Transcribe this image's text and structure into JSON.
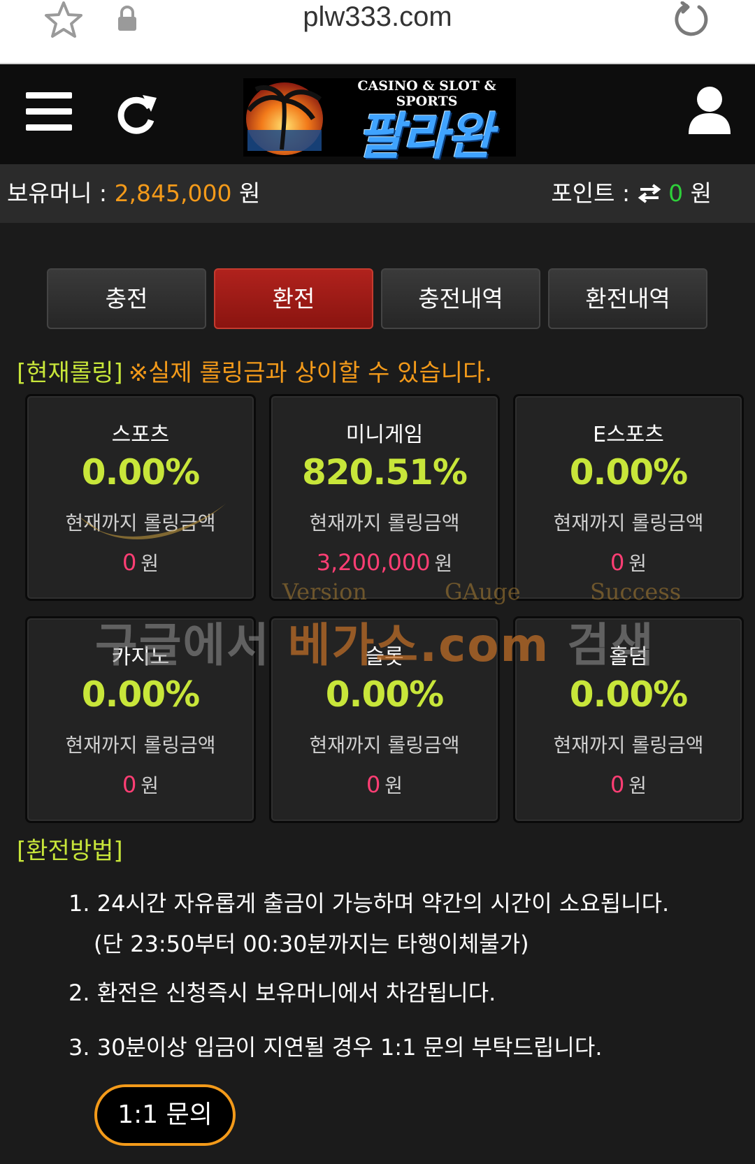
{
  "browser": {
    "url": "plw333.com",
    "icons": [
      "star-icon",
      "lock-icon",
      "reload-icon"
    ]
  },
  "header": {
    "logo_tagline": "CASINO & SLOT & SPORTS",
    "logo_brand": "팔라완",
    "icons": [
      "menu-icon",
      "refresh-icon",
      "user-icon"
    ]
  },
  "balance": {
    "label": "보유머니 :",
    "amount": "2,845,000",
    "unit": "원",
    "point_label": "포인트 :",
    "point_amount": "0",
    "point_unit": "원"
  },
  "tabs": [
    {
      "label": "충전",
      "active": false
    },
    {
      "label": "환전",
      "active": true
    },
    {
      "label": "충전내역",
      "active": false
    },
    {
      "label": "환전내역",
      "active": false
    }
  ],
  "rolling": {
    "title": "[현재롤링]",
    "note": "※실제 롤링금과 상이할 수 있습니다.",
    "cards": [
      {
        "name": "스포츠",
        "pct": "0.00%",
        "sub": "현재까지 롤링금액",
        "amount": "0",
        "unit": "원"
      },
      {
        "name": "미니게임",
        "pct": "820.51%",
        "sub": "현재까지 롤링금액",
        "amount": "3,200,000",
        "unit": "원"
      },
      {
        "name": "E스포츠",
        "pct": "0.00%",
        "sub": "현재까지 롤링금액",
        "amount": "0",
        "unit": "원"
      },
      {
        "name": "카지노",
        "pct": "0.00%",
        "sub": "현재까지 롤링금액",
        "amount": "0",
        "unit": "원"
      },
      {
        "name": "슬롯",
        "pct": "0.00%",
        "sub": "현재까지 롤링금액",
        "amount": "0",
        "unit": "원"
      },
      {
        "name": "홀덤",
        "pct": "0.00%",
        "sub": "현재까지 롤링금액",
        "amount": "0",
        "unit": "원"
      }
    ]
  },
  "watermark": {
    "main_prefix": "구글에서 ",
    "main_brand": "베가스.com",
    "main_suffix": " 검색",
    "words": [
      "Version",
      "GAuge",
      "Success"
    ]
  },
  "method": {
    "title": "[환전방법]",
    "items": [
      {
        "line1": "1. 24시간 자유롭게 출금이 가능하며 약간의 시간이 소요됩니다.",
        "line2": "(단 23:50부터 00:30분까지는 타행이체불가)"
      },
      {
        "line1": "2. 환전은 신청즉시 보유머니에서 차감됩니다.",
        "line2": ""
      },
      {
        "line1": "3. 30분이상 입금이 지연될 경우 1:1 문의 부탁드립니다.",
        "line2": ""
      }
    ]
  },
  "inquiry_button": "1:1 문의",
  "colors": {
    "accent_orange": "#f39a1a",
    "accent_lime": "#c8e63a",
    "amount_pink": "#ff3e74",
    "tab_active_red": "#a01b17"
  }
}
